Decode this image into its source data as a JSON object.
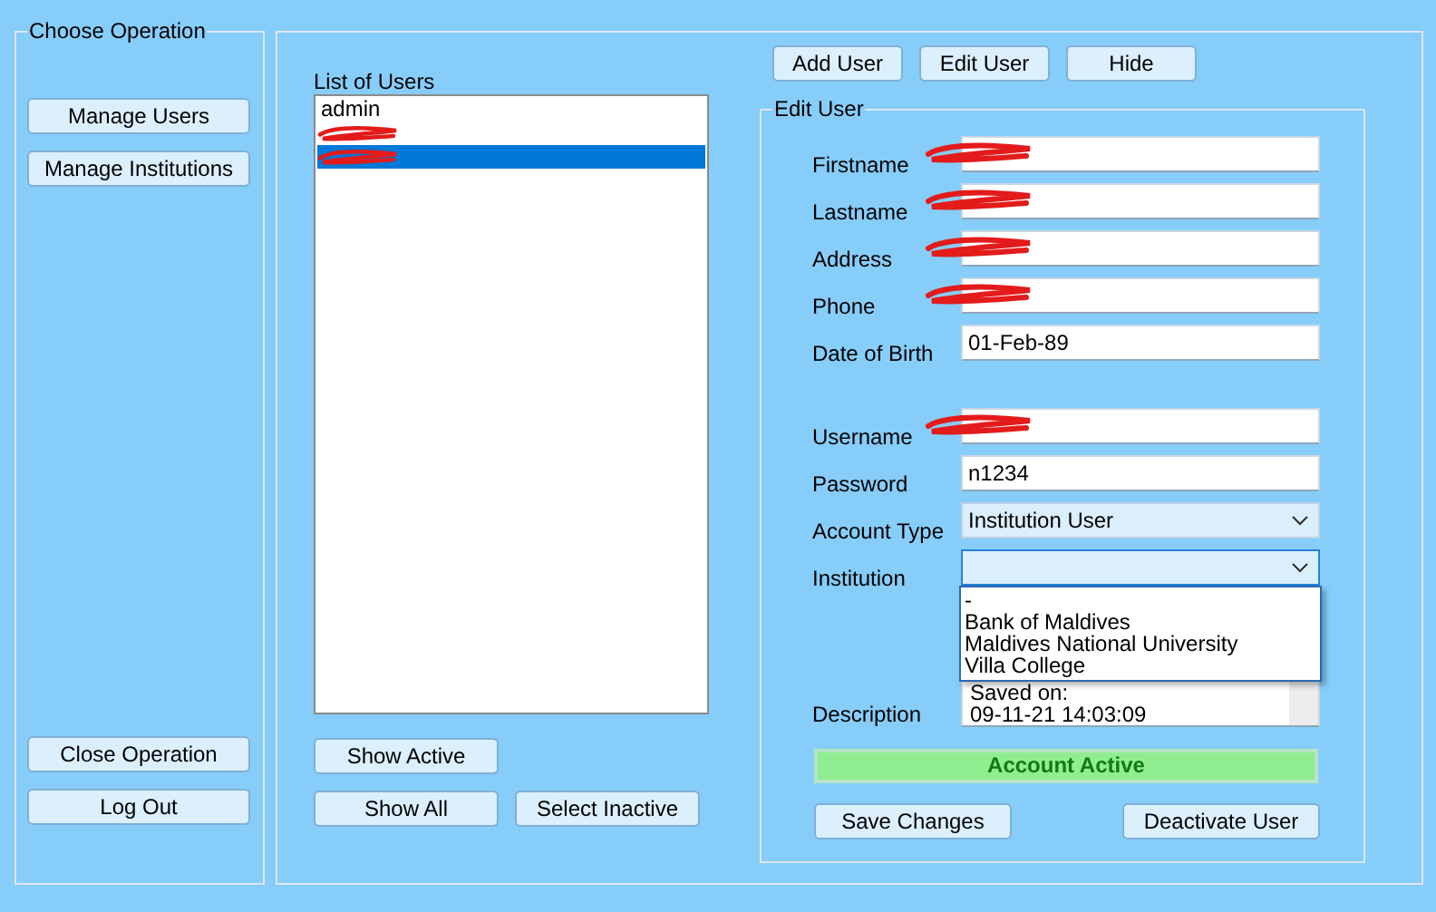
{
  "operations": {
    "title": "Choose Operation",
    "top_buttons": [
      "Manage Users",
      "Manage Institutions"
    ],
    "bottom_buttons": [
      "Close Operation",
      "Log Out"
    ]
  },
  "users": {
    "label": "List of Users",
    "items": [
      {
        "text": "admin",
        "redacted": false,
        "selected": false
      },
      {
        "redacted": true,
        "selected": false
      },
      {
        "redacted": true,
        "selected": true
      }
    ],
    "buttons_row1": [
      "Show Active"
    ],
    "buttons_row2": [
      "Show All",
      "Select Inactive"
    ]
  },
  "actions": [
    "Add User",
    "Edit User",
    "Hide"
  ],
  "edit_user": {
    "title": "Edit User",
    "fields": [
      {
        "kind": "text",
        "label": "Firstname",
        "redacted": true
      },
      {
        "kind": "text",
        "label": "Lastname",
        "redacted": true
      },
      {
        "kind": "text",
        "label": "Address",
        "redacted": true
      },
      {
        "kind": "text",
        "label": "Phone",
        "redacted": true
      },
      {
        "kind": "text",
        "label": "Date of Birth",
        "value": "01-Feb-89",
        "redacted": false
      },
      {
        "kind": "gap"
      },
      {
        "kind": "text",
        "label": "Username",
        "redacted": true
      },
      {
        "kind": "text",
        "label": "Password",
        "value": "n1234",
        "redacted": false
      },
      {
        "kind": "combo",
        "label": "Account Type",
        "value": "Institution User",
        "open": false
      },
      {
        "kind": "combo",
        "label": "Institution",
        "open": true,
        "options": [
          "-",
          "Bank of Maldives",
          "Maldives National University",
          "Villa College"
        ]
      },
      {
        "kind": "memo",
        "label": "Description",
        "lines": [
          "Saved on:",
          "09-11-21 14:03:09"
        ]
      }
    ],
    "status": {
      "text": "Account Active",
      "active": true
    },
    "buttons": [
      "Save Changes",
      "Deactivate User"
    ]
  }
}
